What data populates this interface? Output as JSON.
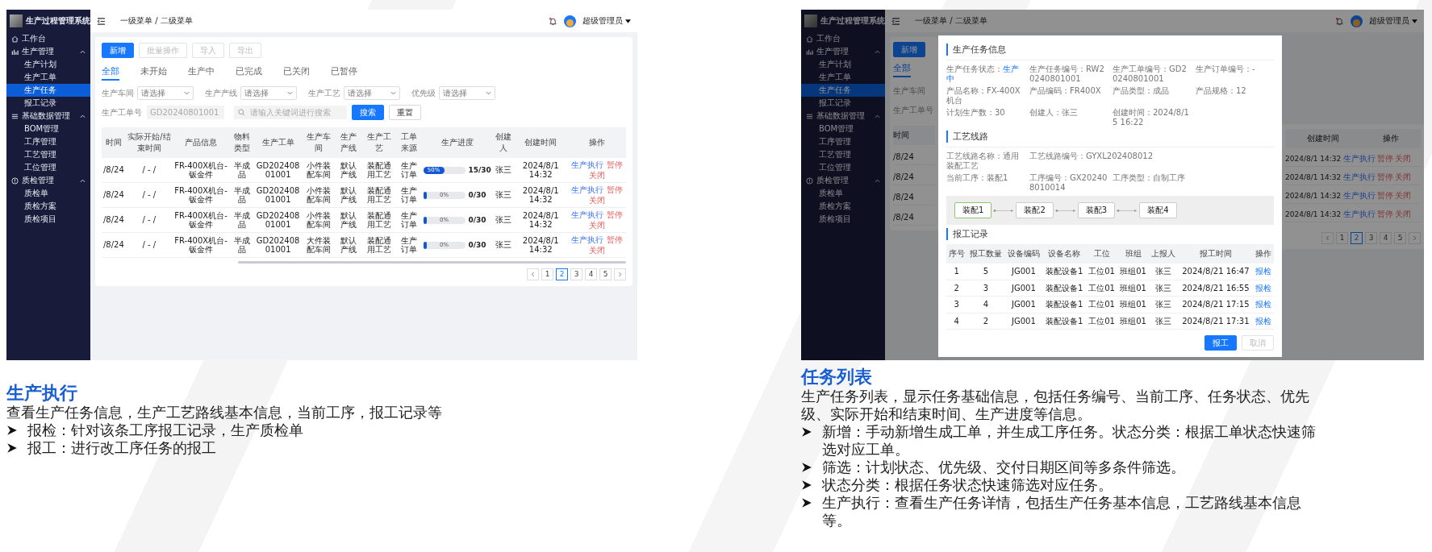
{
  "left_screenshot": {
    "sidebar": {
      "title": "生产过程管理系统",
      "items": [
        {
          "label": "工作台",
          "selected": false
        },
        {
          "label": "生产管理",
          "expanded": true,
          "children": [
            {
              "label": "生产计划",
              "selected": false
            },
            {
              "label": "生产工单",
              "selected": false
            },
            {
              "label": "生产任务",
              "selected": true
            },
            {
              "label": "报工记录",
              "selected": false
            }
          ]
        },
        {
          "label": "基础数据管理",
          "expanded": true,
          "children": [
            {
              "label": "BOM管理",
              "selected": false
            },
            {
              "label": "工序管理",
              "selected": false
            },
            {
              "label": "工艺管理",
              "selected": false
            },
            {
              "label": "工位管理",
              "selected": false
            }
          ]
        },
        {
          "label": "质检管理",
          "expanded": true,
          "children": [
            {
              "label": "质检单",
              "selected": false
            },
            {
              "label": "质检方案",
              "selected": false
            },
            {
              "label": "质检项目",
              "selected": false
            }
          ]
        }
      ]
    },
    "header": {
      "breadcrumb": "一级菜单 / 二级菜单",
      "user": "超级管理员"
    },
    "toolbar": [
      {
        "label": "新增",
        "disabled": false
      },
      {
        "label": "批量操作",
        "disabled": true
      },
      {
        "label": "导入",
        "disabled": true
      },
      {
        "label": "导出",
        "disabled": true
      }
    ],
    "status_tabs": [
      {
        "label": "全部",
        "selected": true
      },
      {
        "label": "未开始",
        "selected": false
      },
      {
        "label": "生产中",
        "selected": false
      },
      {
        "label": "已完成",
        "selected": false
      },
      {
        "label": "已关闭",
        "selected": false
      },
      {
        "label": "已暂停",
        "selected": false
      }
    ],
    "filters": [
      {
        "label": "生产车间",
        "placeholder": "请选择"
      },
      {
        "label": "生产产线",
        "placeholder": "请选择"
      },
      {
        "label": "生产工艺",
        "placeholder": "请选择"
      },
      {
        "label": "优先级",
        "placeholder": "请选择"
      }
    ],
    "order_filter": {
      "label": "生产工单号",
      "placeholder": "GD20240801001"
    },
    "search": {
      "placeholder": "请输入关键词进行搜索"
    },
    "search_buttons": [
      {
        "label": "搜索",
        "kind": "primary"
      },
      {
        "label": "重置",
        "kind": "default"
      }
    ],
    "table": {
      "columns": [
        "时间",
        "实际开始/结束时间",
        "产品信息",
        "物料类型",
        "生产工单",
        "生产车间",
        "生产产线",
        "生产工艺",
        "工单来源",
        "生产进度",
        "创建人",
        "创建时间",
        "操作"
      ],
      "rows": [
        {
          "time": "/8/24",
          "actual": "/ - /",
          "product": "FR-400X机台-钣金件",
          "material": "半成品",
          "order": "GD20240801001",
          "workshop": "小件装配车间",
          "line": "默认产线",
          "process": "装配通用工艺",
          "source": "生产订单",
          "progress": {
            "level": 0.5,
            "label": "50%"
          },
          "count": "15/30",
          "creator": "张三",
          "created": "2024/8/1 14:32",
          "actions": [
            {
              "label": "生产执行",
              "kind": "primary"
            },
            {
              "label": "暂停",
              "kind": "danger"
            },
            {
              "label": "关闭",
              "kind": "danger"
            }
          ]
        },
        {
          "time": "/8/24",
          "actual": "/ - /",
          "product": "FR-400X机台-钣金件",
          "material": "半成品",
          "order": "GD20240801001",
          "workshop": "小件装配车间",
          "line": "默认产线",
          "process": "装配通用工艺",
          "source": "生产订单",
          "progress": {
            "level": 0,
            "label": "0%"
          },
          "count": "0/30",
          "creator": "张三",
          "created": "2024/8/1 14:32",
          "actions": [
            {
              "label": "生产执行",
              "kind": "primary"
            },
            {
              "label": "暂停",
              "kind": "danger"
            },
            {
              "label": "关闭",
              "kind": "danger"
            }
          ]
        },
        {
          "time": "/8/24",
          "actual": "/ - /",
          "product": "FR-400X机台-钣金件",
          "material": "半成品",
          "order": "GD20240801001",
          "workshop": "小件装配车间",
          "line": "默认产线",
          "process": "装配通用工艺",
          "source": "生产订单",
          "progress": {
            "level": 0,
            "label": "0%"
          },
          "count": "0/30",
          "creator": "张三",
          "created": "2024/8/1 14:32",
          "actions": [
            {
              "label": "生产执行",
              "kind": "primary"
            },
            {
              "label": "暂停",
              "kind": "danger"
            },
            {
              "label": "关闭",
              "kind": "danger"
            }
          ]
        },
        {
          "time": "/8/24",
          "actual": "/ - /",
          "product": "FR-400X机台-钣金件",
          "material": "半成品",
          "order": "GD20240801001",
          "workshop": "大件装配车间",
          "line": "默认产线",
          "process": "装配通用工艺",
          "source": "生产订单",
          "progress": {
            "level": 0,
            "label": "0%"
          },
          "count": "0/30",
          "creator": "张三",
          "created": "2024/8/1 14:32",
          "actions": [
            {
              "label": "生产执行",
              "kind": "primary"
            },
            {
              "label": "暂停",
              "kind": "danger"
            },
            {
              "label": "关闭",
              "kind": "danger"
            }
          ]
        }
      ]
    },
    "pagination": [
      {
        "label": "1",
        "selected": false
      },
      {
        "label": "2",
        "selected": true
      },
      {
        "label": "3",
        "selected": false
      },
      {
        "label": "4",
        "selected": false
      },
      {
        "label": "5",
        "selected": false
      }
    ]
  },
  "left_caption": {
    "title": "生产执行",
    "description": "查看生产任务信息，生产工艺路线基本信息，当前工序，报工记录等",
    "bullets": [
      "报检：针对该条工序报工记录，生产质检单",
      "报工：进行改工序任务的报工"
    ]
  },
  "right_screenshot": {
    "sidebar": {
      "title": "生产过程管理系统",
      "items": [
        {
          "label": "工作台",
          "selected": false
        },
        {
          "label": "生产管理",
          "expanded": true,
          "children": [
            {
              "label": "生产计划",
              "selected": false
            },
            {
              "label": "生产工单",
              "selected": false
            },
            {
              "label": "生产任务",
              "selected": true
            },
            {
              "label": "报工记录",
              "selected": false
            }
          ]
        },
        {
          "label": "基础数据管理",
          "expanded": true,
          "children": [
            {
              "label": "BOM管理",
              "selected": false
            },
            {
              "label": "工序管理",
              "selected": false
            },
            {
              "label": "工艺管理",
              "selected": false
            },
            {
              "label": "工位管理",
              "selected": false
            }
          ]
        },
        {
          "label": "质检管理",
          "expanded": true,
          "children": [
            {
              "label": "质检单",
              "selected": false
            },
            {
              "label": "质检方案",
              "selected": false
            },
            {
              "label": "质检项目",
              "selected": false
            }
          ]
        }
      ]
    },
    "header": {
      "breadcrumb": "一级菜单 / 二级菜单",
      "user": "超级管理员"
    },
    "background": {
      "button": "新增",
      "tab": {
        "label": "全部",
        "selected": true
      },
      "labels": [
        "生产车间",
        "生产工单号"
      ],
      "left_heading": "时间",
      "left_cells": [
        "/8/24",
        "/8/24",
        "/8/24",
        "/8/24"
      ],
      "right_headings": [
        "创建时间",
        "操作"
      ],
      "right_rows": [
        {
          "created": "2024/8/1 14:32",
          "actions": [
            {
              "label": "生产执行",
              "kind": "primary"
            },
            {
              "label": "暂停",
              "kind": "danger"
            },
            {
              "label": "关闭",
              "kind": "danger"
            }
          ]
        },
        {
          "created": "2024/8/1 14:32",
          "actions": [
            {
              "label": "生产执行",
              "kind": "primary"
            },
            {
              "label": "暂停",
              "kind": "danger"
            },
            {
              "label": "关闭",
              "kind": "danger"
            }
          ]
        },
        {
          "created": "2024/8/1 14:32",
          "actions": [
            {
              "label": "生产执行",
              "kind": "primary"
            },
            {
              "label": "暂停",
              "kind": "danger"
            },
            {
              "label": "关闭",
              "kind": "danger"
            }
          ]
        },
        {
          "created": "2024/8/1 14:32",
          "actions": [
            {
              "label": "生产执行",
              "kind": "primary"
            },
            {
              "label": "暂停",
              "kind": "danger"
            },
            {
              "label": "关闭",
              "kind": "danger"
            }
          ]
        }
      ],
      "pagination": [
        {
          "label": "1",
          "selected": false
        },
        {
          "label": "2",
          "selected": true
        },
        {
          "label": "3",
          "selected": false
        },
        {
          "label": "4",
          "selected": false
        },
        {
          "label": "5",
          "selected": false
        }
      ]
    },
    "modal": {
      "task_info": {
        "title": "生产任务信息",
        "fields": [
          {
            "label": "生产任务状态：",
            "value": "生产中",
            "kind": "status"
          },
          {
            "label": "生产任务编号：",
            "value": "RW20240801001",
            "kind": "text"
          },
          {
            "label": "生产工单编号：",
            "value": "GD20240801001",
            "kind": "text"
          },
          {
            "label": "生产订单编号：",
            "value": "-",
            "kind": "text"
          },
          {
            "label": "产品名称：",
            "value": "FX-400X机台",
            "kind": "text"
          },
          {
            "label": "产品编码：",
            "value": "FR400X",
            "kind": "text"
          },
          {
            "label": "产品类型：",
            "value": "成品",
            "kind": "text"
          },
          {
            "label": "产品规格：",
            "value": "12",
            "kind": "text"
          },
          {
            "label": "计划生产数：",
            "value": "30",
            "kind": "text"
          },
          {
            "label": "创建人：",
            "value": "张三",
            "kind": "text"
          },
          {
            "label": "创建时间：",
            "value": "2024/8/15 16:22",
            "kind": "text"
          }
        ]
      },
      "route": {
        "title": "工艺线路",
        "fields": [
          {
            "label": "工艺线路名称：",
            "value": "通用装配工艺"
          },
          {
            "label": "工艺线路编号：",
            "value": "GYXL202408012"
          },
          {
            "label": "当前工序：",
            "value": "装配1"
          },
          {
            "label": "工序编号：",
            "value": "GX202408010014"
          },
          {
            "label": "工序类型：",
            "value": "自制工序"
          }
        ],
        "steps": [
          {
            "label": "装配1",
            "current": true
          },
          {
            "label": "装配2",
            "current": false
          },
          {
            "label": "装配3",
            "current": false
          },
          {
            "label": "装配4",
            "current": false
          }
        ]
      },
      "records": {
        "title": "报工记录",
        "columns": [
          "序号",
          "报工数量",
          "设备编码",
          "设备名称",
          "工位",
          "班组",
          "上报人",
          "报工时间",
          "操作"
        ],
        "rows": [
          [
            "1",
            "5",
            "JG001",
            "装配设备1",
            "工位01",
            "班组01",
            "张三",
            "2024/8/21 16:47",
            "报检"
          ],
          [
            "2",
            "3",
            "JG001",
            "装配设备1",
            "工位01",
            "班组01",
            "张三",
            "2024/8/21 16:55",
            "报检"
          ],
          [
            "3",
            "4",
            "JG001",
            "装配设备1",
            "工位01",
            "班组01",
            "张三",
            "2024/8/21 17:15",
            "报检"
          ],
          [
            "4",
            "2",
            "JG001",
            "装配设备1",
            "工位01",
            "班组01",
            "张三",
            "2024/8/21 17:31",
            "报检"
          ]
        ]
      },
      "buttons": [
        {
          "label": "报工",
          "kind": "primary"
        },
        {
          "label": "取消",
          "kind": "disabled"
        }
      ]
    }
  },
  "right_caption": {
    "title": "任务列表",
    "description": "生产任务列表，显示任务基础信息，包括任务编号、当前工序、任务状态、优先级、实际开始和结束时间、生产进度等信息。",
    "bullets": [
      "新增：手动新增生成工单，并生成工序任务。状态分类：根据工单状态快速筛选对应工单。",
      "筛选：计划状态、优先级、交付日期区间等多条件筛选。",
      "状态分类：根据任务状态快速筛选对应任务。",
      "生产执行：查看生产任务详情，包括生产任务基本信息，工艺路线基本信息等。"
    ]
  }
}
